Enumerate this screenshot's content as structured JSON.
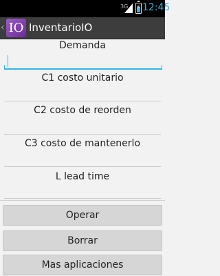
{
  "status_bar": {
    "signal_badge": "3G",
    "time": "12:45",
    "icons": [
      "signal-icon",
      "battery-charging-icon"
    ]
  },
  "action_bar": {
    "logo_text": "IO",
    "title": "InventarioIO"
  },
  "form": {
    "demanda": {
      "label": "Demanda",
      "value": ""
    },
    "c1": {
      "label": "C1 costo unitario"
    },
    "c2": {
      "label": "C2 costo de reorden"
    },
    "c3": {
      "label": "C3 costo de mantenerlo"
    },
    "l": {
      "label": "L lead time"
    }
  },
  "buttons": {
    "operar": "Operar",
    "borrar": "Borrar",
    "mas": "Mas aplicaciones"
  },
  "colors": {
    "accent": "#33b5e5",
    "action_bar": "#3d3d3d",
    "background": "#f2f2f2",
    "button": "#d6d6d6",
    "logo": "#8a4bb8"
  }
}
